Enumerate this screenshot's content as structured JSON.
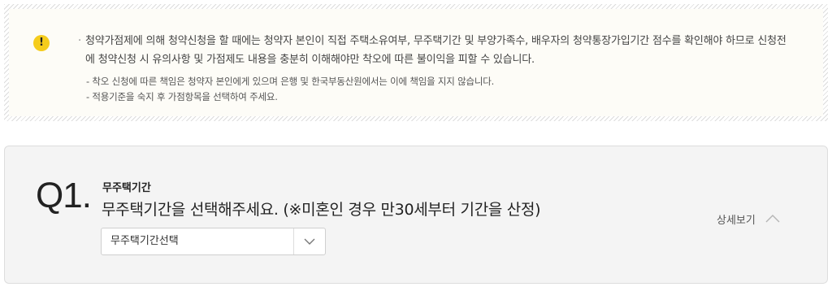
{
  "notice": {
    "icon": "exclamation-icon",
    "icon_glyph": "!",
    "icon_color": "#f5cc1c",
    "main_bullet": "·",
    "main_text": "청약가점제에 의해 청약신청을 할 때에는 청약자 본인이 직접 주택소유여부, 무주택기간 및 부양가족수, 배우자의 청약통장가입기간 점수를 확인해야 하므로 신청전에 청약신청 시 유의사항 및 가점제도 내용을 충분히 이해해야만 착오에 따른 불이익을 피할 수 있습니다.",
    "sub_items": [
      "- 착오 신청에 따른 책임은 청약자 본인에게 있으며 은행 및 한국부동산원에서는 이에 책임을 지지 않습니다.",
      "- 적용기준을 숙지 후 가점항목을 선택하여 주세요."
    ]
  },
  "question": {
    "number": "Q1.",
    "category": "무주택기간",
    "text": "무주택기간을 선택해주세요. (※미혼인 경우 만30세부터 기간을 산정)",
    "select": {
      "value": "무주택기간선택",
      "icon": "chevron-down-icon"
    },
    "detail_label": "상세보기",
    "detail_icon": "chevron-up-icon"
  }
}
